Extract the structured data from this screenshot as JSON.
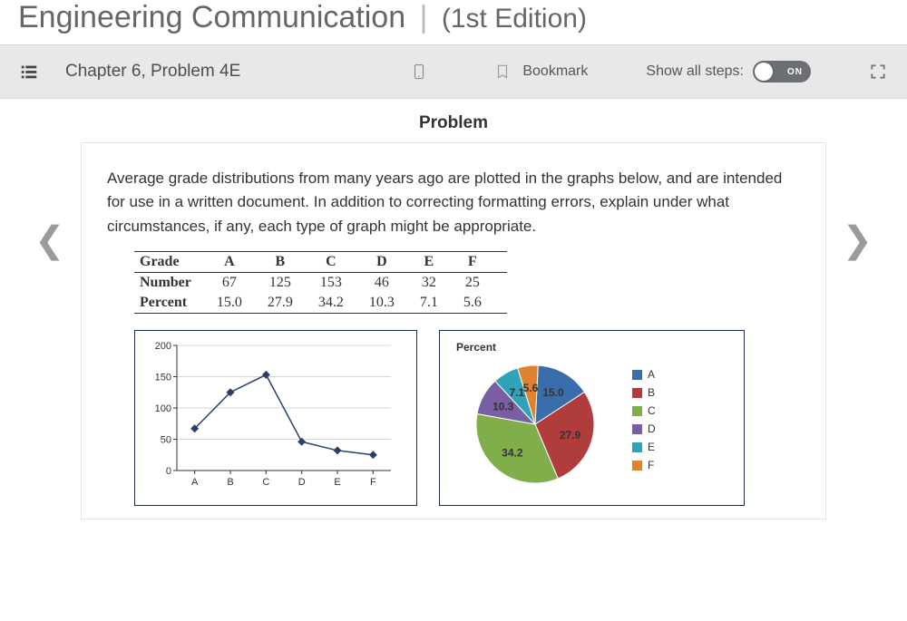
{
  "book": {
    "title": "Engineering Communication",
    "edition": "(1st Edition)"
  },
  "toolbar": {
    "crumb": "Chapter 6, Problem 4E",
    "bookmark_label": "Bookmark",
    "steps_label": "Show all steps:",
    "toggle_on": "ON"
  },
  "section_title": "Problem",
  "problem_text": "Average grade distributions from many years ago are plotted in the graphs below, and are intended for use in a written document. In addition to correcting formatting errors, explain under what circumstances, if any, each type of graph might be appropriate.",
  "table": {
    "headers": [
      "Grade",
      "A",
      "B",
      "C",
      "D",
      "E",
      "F"
    ],
    "rows": [
      [
        "Number",
        "67",
        "125",
        "153",
        "46",
        "32",
        "25"
      ],
      [
        "Percent",
        "15.0",
        "27.9",
        "34.2",
        "10.3",
        "7.1",
        "5.6"
      ]
    ]
  },
  "chart_data": [
    {
      "type": "line",
      "categories": [
        "A",
        "B",
        "C",
        "D",
        "E",
        "F"
      ],
      "values": [
        67,
        125,
        153,
        46,
        32,
        25
      ],
      "ylim": [
        0,
        200
      ],
      "yticks": [
        0,
        50,
        100,
        150,
        200
      ]
    },
    {
      "type": "pie",
      "title": "Percent",
      "series": [
        {
          "name": "A",
          "value": 15.0,
          "color": "var(--pie-A)"
        },
        {
          "name": "B",
          "value": 27.9,
          "color": "var(--pie-B)"
        },
        {
          "name": "C",
          "value": 34.2,
          "color": "var(--pie-C)"
        },
        {
          "name": "D",
          "value": 10.3,
          "color": "var(--pie-D)"
        },
        {
          "name": "E",
          "value": 7.1,
          "color": "var(--pie-E)"
        },
        {
          "name": "F",
          "value": 5.6,
          "color": "var(--pie-F)"
        }
      ]
    }
  ]
}
